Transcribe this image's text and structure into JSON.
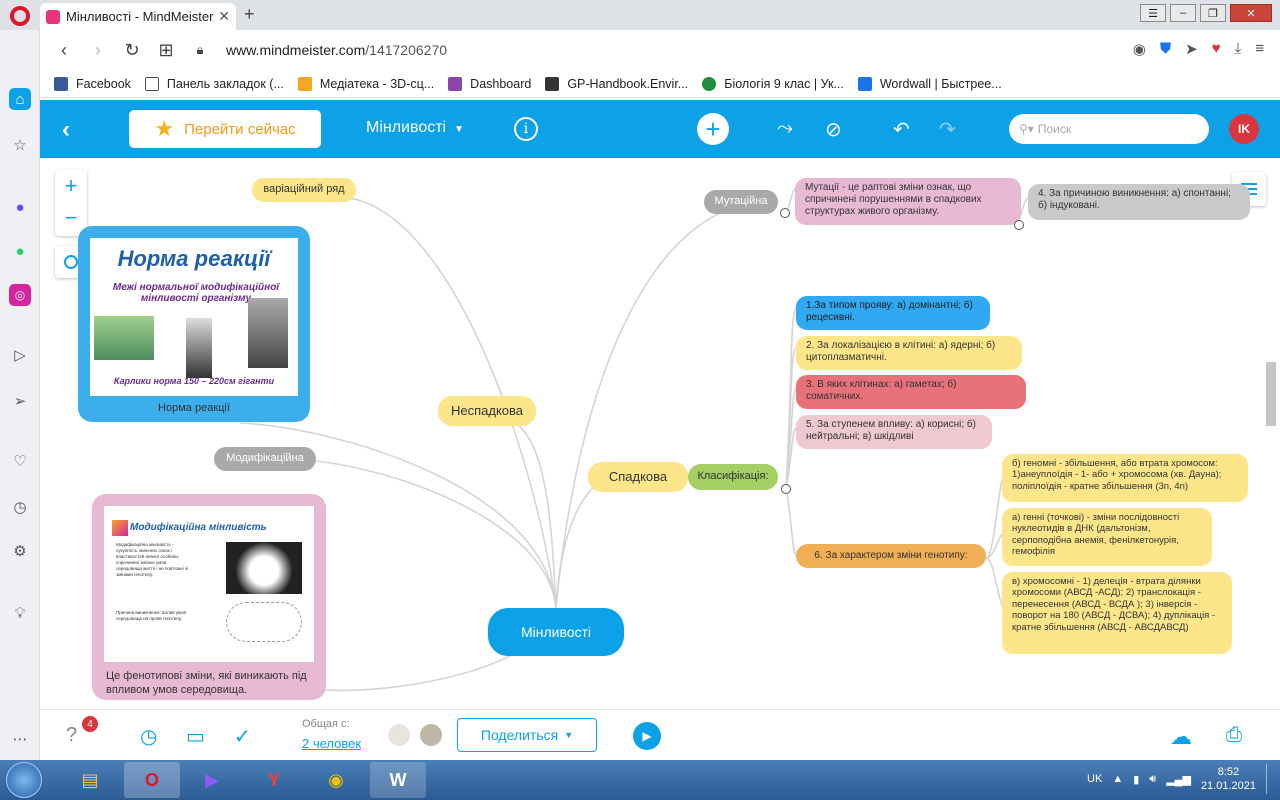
{
  "browser": {
    "tab_title": "Мінливості - MindMeister",
    "url_host": "www.mindmeister.com",
    "url_path": "/1417206270",
    "bookmarks": [
      {
        "label": "Facebook",
        "color": "#3b5998"
      },
      {
        "label": "Панель закладок (...",
        "color": "#ffffff"
      },
      {
        "label": "Медіатека - 3D-сц...",
        "color": "#f5a623"
      },
      {
        "label": "Dashboard",
        "color": "#8e44ad"
      },
      {
        "label": "GP-Handbook.Envir...",
        "color": "#333333"
      },
      {
        "label": "Біологія 9 клас | Ук...",
        "color": "#1e8e3e"
      },
      {
        "label": "Wordwall | Быстрее...",
        "color": "#1a73e8"
      }
    ]
  },
  "toolbar": {
    "goto_label": "Перейти сейчас",
    "map_name": "Мінливості",
    "search_placeholder": "Поиск",
    "avatar_initials": "IK"
  },
  "map": {
    "root": "Мінливості",
    "nodes": {
      "variation_series": "варіаційний ряд",
      "norma_caption": "Норма реакції",
      "nonhereditary": "Неспадкова",
      "modification": "Модифікаційна",
      "mod_caption": "Це фенотипові зміни, які виникають під впливом умов середовища.",
      "hereditary": "Спадкова",
      "classification": "Класифікація:",
      "mutational": "Мутаційна",
      "mutation_def": "Мутації - це раптові зміни ознак, що спричинені порушеннями  в спадкових структурах живого організму.",
      "by_cause": "4. За причиною виникнення: а) спонтанні; б) індуковані.",
      "c1": "1.За типом прояву: а) домінантні; б) рецесивні.",
      "c2": "2. За локалізацією в клітині: а) ядерні; б) цитоплазматичні.",
      "c3": "3. В яких клітинах: а) гаметах; б) соматичних.",
      "c5": "5. За ступенем впливу: а) корисні; б) нейтральні; в) шкідливі",
      "c6": "6. За характером зміни генотипу:",
      "g_genomic": "б) геномні - збільшення, або втрата хромосом: 1)анеуплоїдія - 1- або + хромосома (хв. Дауна); поліплоїдія - кратне збільшення (3n, 4n)",
      "g_gene": "а) генні (точкові) - зміни послідовності нуклеотидів в ДНК (дальтонізм, серпоподібна анемія, фенілкетонурія, гемофілія",
      "g_chromo": "в) хромосомні - 1) делеція - втрата ділянки хромосоми (АВСД -АСД);          2) транслокація - перенесення (АВСД - ВСДА ); 3) інверсія - поворот на 180  (АВСД - ДСВА); 4) дуплікація - кратне збільшення (АВСД - АВСДАВСД)"
    },
    "norma_image": {
      "title": "Норма реакції",
      "subtitle": "Межі нормальної модифікаційної мінливості організму",
      "bottom": "Карлики   норма 150 – 220см  гіганти"
    },
    "mod_image": {
      "title": "Модифікаційна мінливість",
      "text1": "Модифікаційна мінливість - сукупність змінених ознак і властивостей певної особини, спричинені зміною умов середовища життя і не пов'язані зі змінами генотипу.",
      "text2": "Причина виникнення: вплив умов середовища на прояв генотипу."
    }
  },
  "bottom": {
    "notif_count": "4",
    "shared_label": "Общая с:",
    "shared_count": "2 человек",
    "share_label": "Поделиться"
  },
  "taskbar": {
    "lang": "UK",
    "time": "8:52",
    "date": "21.01.2021"
  }
}
